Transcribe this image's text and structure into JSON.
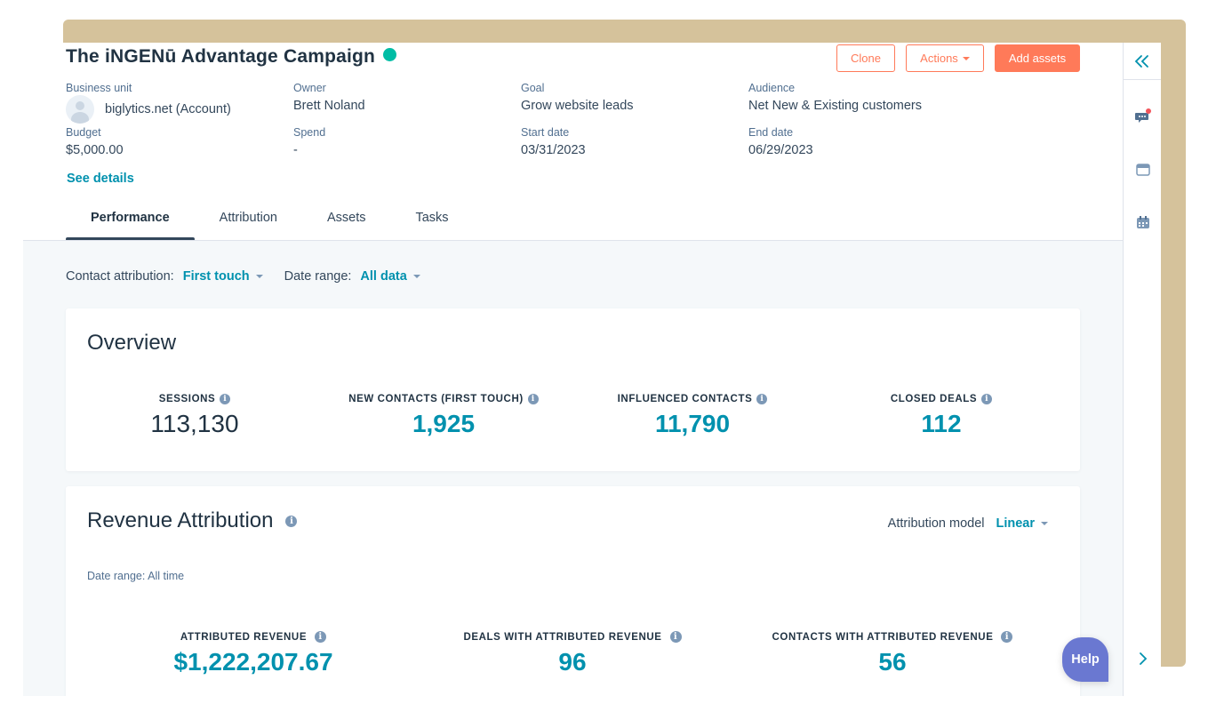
{
  "header": {
    "title": "The iNGENū Advantage Campaign",
    "status_color": "#00bda5",
    "buttons": {
      "clone": "Clone",
      "actions": "Actions",
      "add_assets": "Add assets"
    },
    "fields": {
      "business_unit": {
        "label": "Business unit",
        "value": "biglytics.net (Account)"
      },
      "owner": {
        "label": "Owner",
        "value": "Brett Noland"
      },
      "goal": {
        "label": "Goal",
        "value": "Grow website leads"
      },
      "audience": {
        "label": "Audience",
        "value": "Net New & Existing customers"
      },
      "budget": {
        "label": "Budget",
        "value": "$5,000.00"
      },
      "spend": {
        "label": "Spend",
        "value": "-"
      },
      "start_date": {
        "label": "Start date",
        "value": "03/31/2023"
      },
      "end_date": {
        "label": "End date",
        "value": "06/29/2023"
      }
    },
    "see_details": "See details"
  },
  "tabs": [
    {
      "label": "Performance",
      "active": true
    },
    {
      "label": "Attribution",
      "active": false
    },
    {
      "label": "Assets",
      "active": false
    },
    {
      "label": "Tasks",
      "active": false
    }
  ],
  "filters": {
    "contact_attribution": {
      "label": "Contact attribution:",
      "value": "First touch"
    },
    "date_range": {
      "label": "Date range:",
      "value": "All data"
    }
  },
  "overview": {
    "title": "Overview",
    "metrics": [
      {
        "label": "SESSIONS",
        "value": "113,130"
      },
      {
        "label": "NEW CONTACTS (FIRST TOUCH)",
        "value": "1,925"
      },
      {
        "label": "INFLUENCED CONTACTS",
        "value": "11,790"
      },
      {
        "label": "CLOSED DEALS",
        "value": "112"
      }
    ]
  },
  "revenue_attribution": {
    "title": "Revenue Attribution",
    "model_label": "Attribution model",
    "model_value": "Linear",
    "date_range_note": "Date range: All time",
    "metrics": [
      {
        "label": "ATTRIBUTED REVENUE",
        "value": "$1,222,207.67"
      },
      {
        "label": "DEALS WITH ATTRIBUTED REVENUE",
        "value": "96"
      },
      {
        "label": "CONTACTS WITH ATTRIBUTED REVENUE",
        "value": "56"
      }
    ]
  },
  "sidebar": {
    "icons": [
      "collapse-double-chevron-icon",
      "chat-icon",
      "card-icon",
      "calendar-icon",
      "expand-chevron-icon"
    ],
    "notification_color": "#f2545b"
  },
  "help": {
    "label": "Help"
  },
  "colors": {
    "accent": "#0091ae",
    "primary_button": "#ff7a59",
    "help": "#6a78d1",
    "tan_backdrop": "#d5c29b"
  }
}
